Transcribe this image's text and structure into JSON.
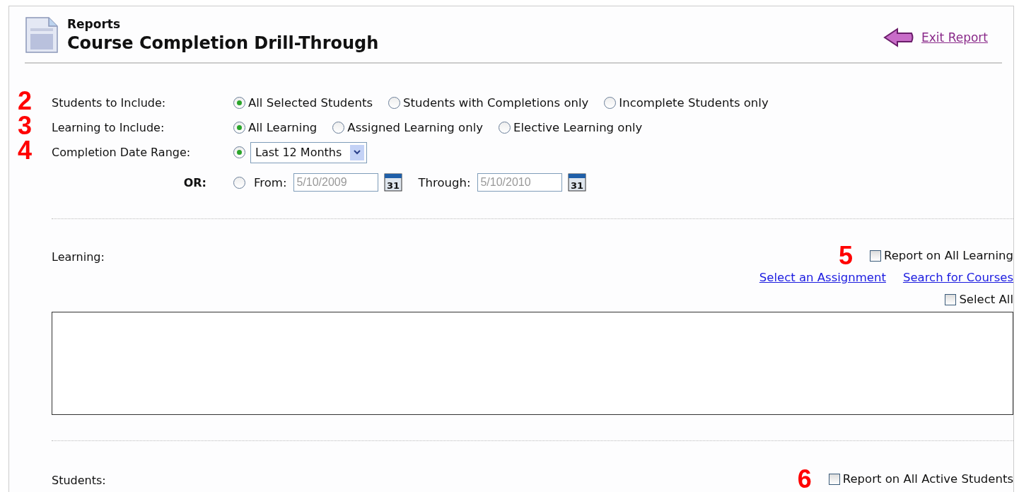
{
  "header": {
    "section": "Reports",
    "title": "Course Completion Drill-Through",
    "exit_link": "Exit Report"
  },
  "options": [
    {
      "callout": "2",
      "label": "Students to Include:",
      "kind": "radios",
      "choices": [
        {
          "label": "All Selected Students",
          "selected": true
        },
        {
          "label": "Students with Completions only",
          "selected": false
        },
        {
          "label": "Incomplete Students only",
          "selected": false
        }
      ]
    },
    {
      "callout": "3",
      "label": "Learning to Include:",
      "kind": "radios",
      "choices": [
        {
          "label": "All Learning",
          "selected": true
        },
        {
          "label": "Assigned Learning only",
          "selected": false
        },
        {
          "label": "Elective Learning only",
          "selected": false
        }
      ]
    },
    {
      "callout": "4",
      "label": "Completion Date Range:",
      "kind": "dropdown",
      "selected": true,
      "value": "Last 12 Months"
    },
    {
      "label": "OR:",
      "kind": "date_range",
      "selected": false,
      "disabled": true,
      "from_label": "From:",
      "from": "5/10/2009",
      "from_calendar_day": "31",
      "through_label": "Through:",
      "through": "5/10/2010",
      "through_calendar_day": "31"
    }
  ],
  "learning": {
    "label": "Learning:",
    "callout": "5",
    "report_all": {
      "label": "Report on All Learning",
      "checked": false
    },
    "links": [
      "Select an Assignment",
      "Search for Courses"
    ],
    "select_all": {
      "label": "Select All",
      "checked": false
    }
  },
  "students": {
    "label": "Students:",
    "callout": "6",
    "report_all": {
      "label": "Report on All Active Students",
      "checked": false
    }
  }
}
